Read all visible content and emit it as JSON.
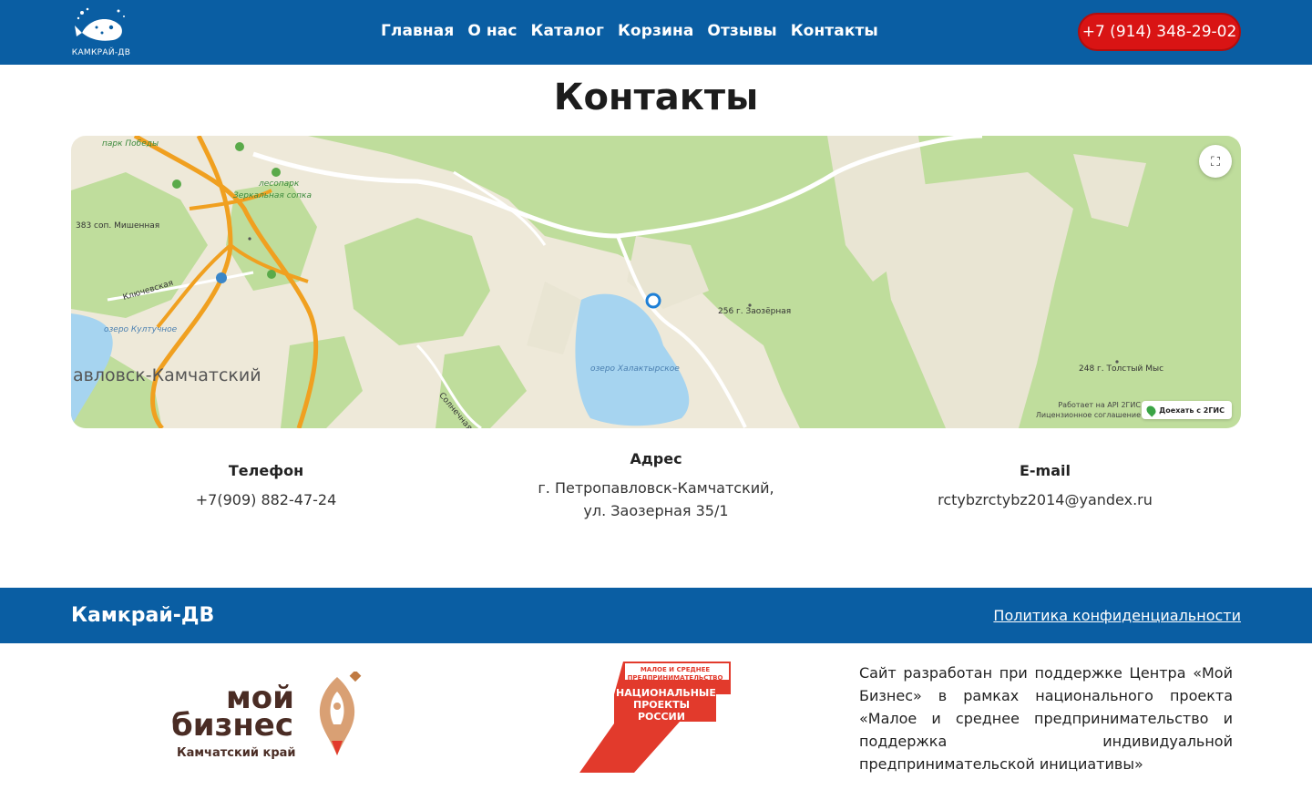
{
  "header": {
    "logo_text": "КАМКРАЙ-ДВ",
    "nav": [
      "Главная",
      "О нас",
      "Каталог",
      "Корзина",
      "Отзывы",
      "Контакты"
    ],
    "phone": "+7 (914) 348-29-02"
  },
  "page_title": "Контакты",
  "map": {
    "labels": {
      "park": "парк Победы",
      "lesopark": "лесопарк",
      "zerkalnaya": "Зеркальная сопка",
      "mishennaya": "383 соп. Мишенная",
      "klyuchevskaya": "Ключевская",
      "kultuchnoe": "озеро Култучное",
      "city": "авловск-Камчатский",
      "khalaktyrskoe": "озеро Халактырское",
      "solnechnaya": "Солнечная",
      "zaozernaya": "256 г. Заозёрная",
      "tolstyi": "248 г. Толстый Мыс"
    },
    "attribution_line1": "Работает на API 2ГИС",
    "attribution_line2": "Лицензионное соглашение",
    "route_button": "Доехать с 2ГИС",
    "fullscreen_icon": "expand-icon"
  },
  "contacts": {
    "phone": {
      "title": "Телефон",
      "value": "+7(909) 882-47-24"
    },
    "address": {
      "title": "Адрес",
      "line1": "г. Петропавловск-Камчатский,",
      "line2": "ул. Заозерная 35/1"
    },
    "email": {
      "title": "E-mail",
      "value": "rctybzrctybz2014@yandex.ru"
    }
  },
  "footer": {
    "brand": "Камкрай-ДВ",
    "privacy": "Политика конфиденциальности",
    "moy_biznes": {
      "line1": "мой",
      "line2": "бизнес",
      "line3": "Камчатский край"
    },
    "nat_projects": {
      "small": "МАЛОЕ И СРЕДНЕЕ ПРЕДПРИНИМАТЕЛЬСТВО",
      "big": "НАЦИОНАЛЬНЫЕ ПРОЕКТЫ РОССИИ"
    },
    "support_text": "Сайт разработан при поддержке Центра «Мой Бизнес» в рамках национального проекта «Малое и среднее предпринимательство и поддержка индивидуальной предпринимательской инициативы»"
  },
  "colors": {
    "header_bg": "#0a5ea3",
    "phone_button": "#d91414",
    "map_forest": "#bcdc9a",
    "map_water": "#a6d4f0",
    "map_road": "#f0a020",
    "brand_brown": "#4a2c24",
    "np_red": "#e23a2c"
  }
}
